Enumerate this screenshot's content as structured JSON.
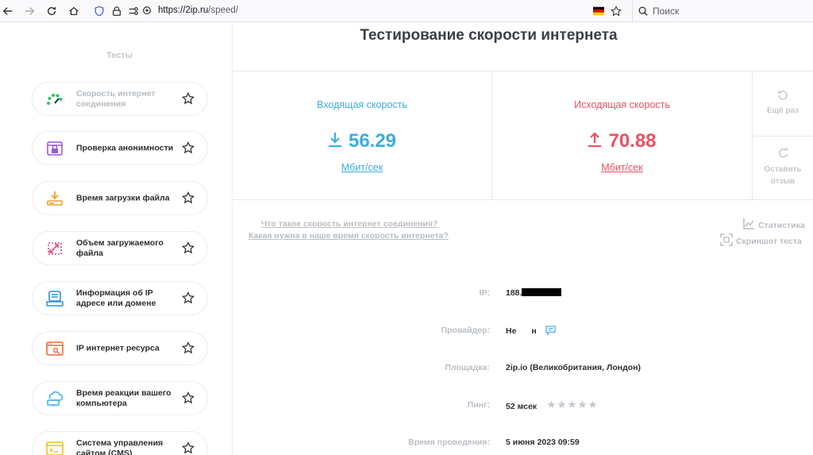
{
  "browser": {
    "url_host": "https://2ip.ru",
    "url_path": "/speed/",
    "search_placeholder": "Поиск"
  },
  "sidebar": {
    "title": "Тесты",
    "items": [
      {
        "label": "Скорость интернет соединения",
        "icon": "speedometer-icon",
        "active": true
      },
      {
        "label": "Проверка анонимности",
        "icon": "anonymity-icon"
      },
      {
        "label": "Время загрузки файла",
        "icon": "download-file-icon"
      },
      {
        "label": "Объем загружаемого файла",
        "icon": "file-size-icon"
      },
      {
        "label": "Информация об IP адресе или домене",
        "icon": "ip-info-icon"
      },
      {
        "label": "IP интернет ресурса",
        "icon": "web-resource-icon"
      },
      {
        "label": "Время реакции вашего компьютера",
        "icon": "reaction-time-icon"
      },
      {
        "label": "Система управления сайтом (CMS)",
        "icon": "cms-icon"
      }
    ]
  },
  "main": {
    "title": "Тестирование скорости интернета",
    "download": {
      "label": "Входящая скорость",
      "value": "56.29",
      "unit": "Мбит/сек"
    },
    "upload": {
      "label": "Исходящая скорость",
      "value": "70.88",
      "unit": "Мбит/сек"
    },
    "actions": {
      "repeat": "Ещё раз",
      "review": "Оставить отзыв"
    },
    "links": [
      "Что такое скорость интернет соединения?",
      "Какая нужна в наше время скорость интернета?"
    ],
    "tools": {
      "stats": "Статистика",
      "screenshot": "Скриншот теста"
    },
    "info": {
      "ip_label": "IP:",
      "ip_value": "188.",
      "provider_label": "Провайдер:",
      "provider_value_a": "Не",
      "provider_value_b": "н",
      "site_label": "Площадка:",
      "site_value": "2ip.io (Великобритания, Лондон)",
      "ping_label": "Пинг:",
      "ping_value": "52 мсек",
      "ping_rating": 0,
      "ping_rating_max": 5,
      "time_label": "Время проведения:",
      "time_value": "5 июня 2023 09:59"
    }
  },
  "colors": {
    "download": "#3aaee0",
    "upload": "#ee4f63",
    "muted": "#b9bec4"
  }
}
